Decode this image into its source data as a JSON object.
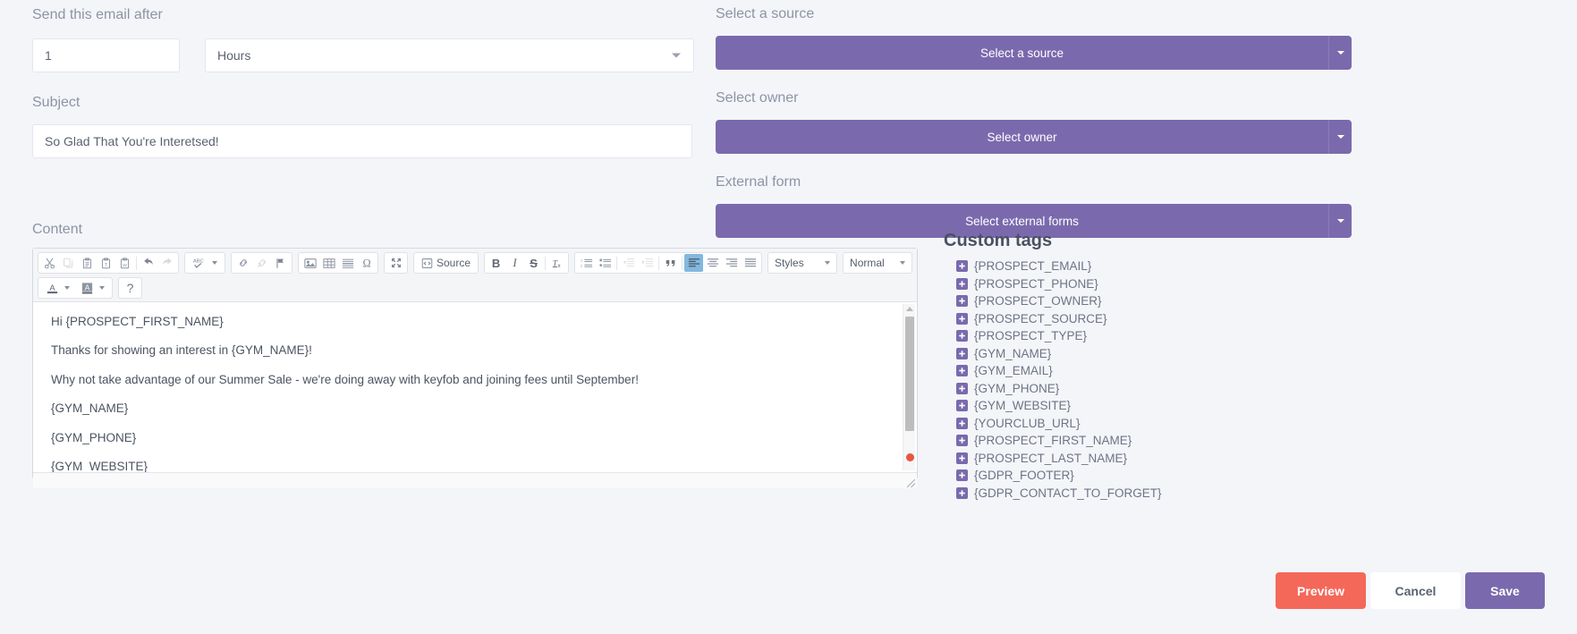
{
  "left": {
    "delay_label": "Send this email after",
    "delay_value": "1",
    "delay_unit": "Hours",
    "subject_label": "Subject",
    "subject_value": "So Glad That You're Interetsed!"
  },
  "right": {
    "source_label": "Select a source",
    "source_value": "Select a source",
    "owner_label": "Select owner",
    "owner_value": "Select owner",
    "form_label": "External form",
    "form_value": "Select external forms"
  },
  "content": {
    "label": "Content",
    "toolbar": {
      "spellcheck": "ABC",
      "source": "Source",
      "bold": "B",
      "italic": "I",
      "strike": "S",
      "remove_format": "Tx",
      "styles": "Styles",
      "format": "Normal",
      "text_color": "A",
      "bg_color": "A",
      "help": "?"
    },
    "paragraphs": [
      "Hi {PROSPECT_FIRST_NAME}",
      "Thanks for showing an interest in {GYM_NAME}!",
      "Why not take advantage of our Summer Sale - we're doing away with keyfob and joining fees until September!",
      "{GYM_NAME}",
      "{GYM_PHONE}",
      "{GYM_WEBSITE}"
    ]
  },
  "tags": {
    "title": "Custom tags",
    "items": [
      "{PROSPECT_EMAIL}",
      "{PROSPECT_PHONE}",
      "{PROSPECT_OWNER}",
      "{PROSPECT_SOURCE}",
      "{PROSPECT_TYPE}",
      "{GYM_NAME}",
      "{GYM_EMAIL}",
      "{GYM_PHONE}",
      "{GYM_WEBSITE}",
      "{YOURCLUB_URL}",
      "{PROSPECT_FIRST_NAME}",
      "{PROSPECT_LAST_NAME}",
      "{GDPR_FOOTER}",
      "{GDPR_CONTACT_TO_FORGET}"
    ]
  },
  "footer": {
    "preview": "Preview",
    "cancel": "Cancel",
    "save": "Save"
  },
  "colors": {
    "purple": "#7a6aad",
    "coral": "#f4685a",
    "page_bg": "#f4f5f9",
    "label": "#8c94a5"
  }
}
